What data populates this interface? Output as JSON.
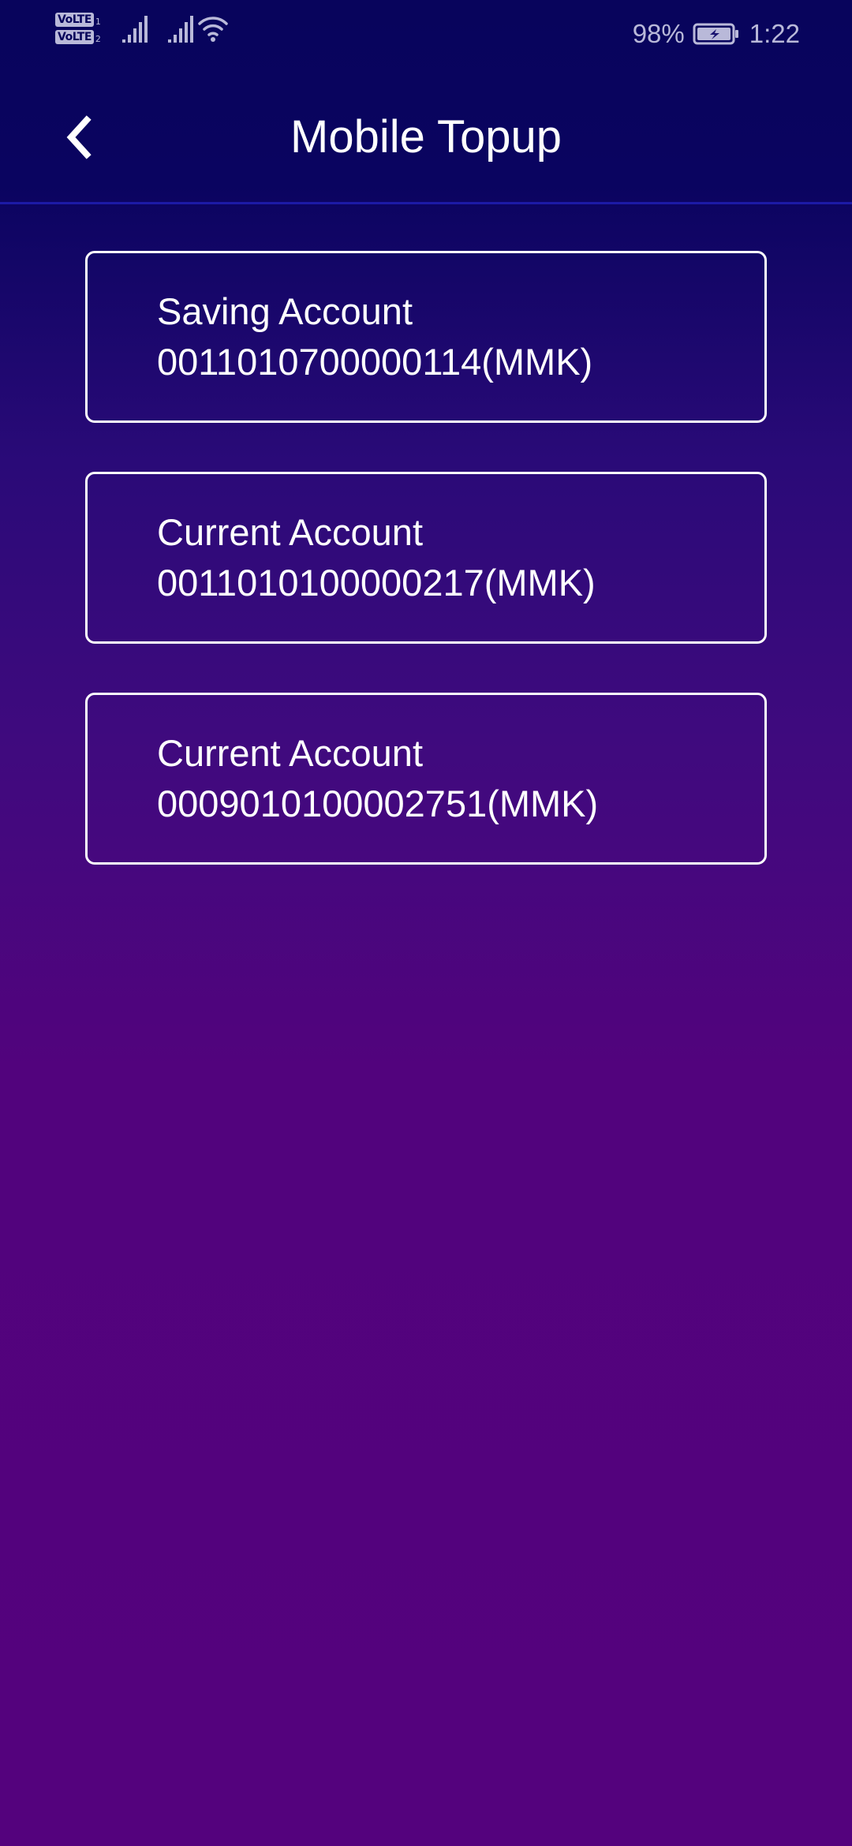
{
  "status_bar": {
    "sim1_label": "VoLTE",
    "sim1_index": "1",
    "sim2_label": "VoLTE",
    "sim2_index": "2",
    "battery_percent": "98%",
    "time": "1:22"
  },
  "header": {
    "title": "Mobile Topup",
    "back_icon": "chevron-left-icon"
  },
  "accounts": [
    {
      "type": "Saving Account",
      "number": "0011010700000114(MMK)"
    },
    {
      "type": "Current Account",
      "number": "0011010100000217(MMK)"
    },
    {
      "type": "Current Account",
      "number": "0009010100002751(MMK)"
    }
  ],
  "colors": {
    "background_top": "#08045c",
    "background_bottom": "#54027d",
    "header_divider": "#1c1aa6",
    "text": "#ffffff",
    "status_text": "#b9b9d9"
  }
}
